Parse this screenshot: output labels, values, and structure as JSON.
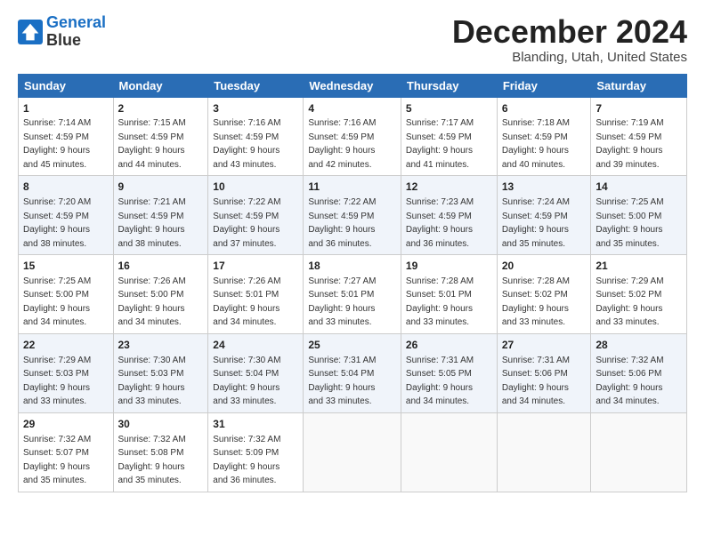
{
  "header": {
    "logo_line1": "General",
    "logo_line2": "Blue",
    "title": "December 2024",
    "subtitle": "Blanding, Utah, United States"
  },
  "days_of_week": [
    "Sunday",
    "Monday",
    "Tuesday",
    "Wednesday",
    "Thursday",
    "Friday",
    "Saturday"
  ],
  "weeks": [
    [
      {
        "day": "1",
        "info": "Sunrise: 7:14 AM\nSunset: 4:59 PM\nDaylight: 9 hours\nand 45 minutes."
      },
      {
        "day": "2",
        "info": "Sunrise: 7:15 AM\nSunset: 4:59 PM\nDaylight: 9 hours\nand 44 minutes."
      },
      {
        "day": "3",
        "info": "Sunrise: 7:16 AM\nSunset: 4:59 PM\nDaylight: 9 hours\nand 43 minutes."
      },
      {
        "day": "4",
        "info": "Sunrise: 7:16 AM\nSunset: 4:59 PM\nDaylight: 9 hours\nand 42 minutes."
      },
      {
        "day": "5",
        "info": "Sunrise: 7:17 AM\nSunset: 4:59 PM\nDaylight: 9 hours\nand 41 minutes."
      },
      {
        "day": "6",
        "info": "Sunrise: 7:18 AM\nSunset: 4:59 PM\nDaylight: 9 hours\nand 40 minutes."
      },
      {
        "day": "7",
        "info": "Sunrise: 7:19 AM\nSunset: 4:59 PM\nDaylight: 9 hours\nand 39 minutes."
      }
    ],
    [
      {
        "day": "8",
        "info": "Sunrise: 7:20 AM\nSunset: 4:59 PM\nDaylight: 9 hours\nand 38 minutes."
      },
      {
        "day": "9",
        "info": "Sunrise: 7:21 AM\nSunset: 4:59 PM\nDaylight: 9 hours\nand 38 minutes."
      },
      {
        "day": "10",
        "info": "Sunrise: 7:22 AM\nSunset: 4:59 PM\nDaylight: 9 hours\nand 37 minutes."
      },
      {
        "day": "11",
        "info": "Sunrise: 7:22 AM\nSunset: 4:59 PM\nDaylight: 9 hours\nand 36 minutes."
      },
      {
        "day": "12",
        "info": "Sunrise: 7:23 AM\nSunset: 4:59 PM\nDaylight: 9 hours\nand 36 minutes."
      },
      {
        "day": "13",
        "info": "Sunrise: 7:24 AM\nSunset: 4:59 PM\nDaylight: 9 hours\nand 35 minutes."
      },
      {
        "day": "14",
        "info": "Sunrise: 7:25 AM\nSunset: 5:00 PM\nDaylight: 9 hours\nand 35 minutes."
      }
    ],
    [
      {
        "day": "15",
        "info": "Sunrise: 7:25 AM\nSunset: 5:00 PM\nDaylight: 9 hours\nand 34 minutes."
      },
      {
        "day": "16",
        "info": "Sunrise: 7:26 AM\nSunset: 5:00 PM\nDaylight: 9 hours\nand 34 minutes."
      },
      {
        "day": "17",
        "info": "Sunrise: 7:26 AM\nSunset: 5:01 PM\nDaylight: 9 hours\nand 34 minutes."
      },
      {
        "day": "18",
        "info": "Sunrise: 7:27 AM\nSunset: 5:01 PM\nDaylight: 9 hours\nand 33 minutes."
      },
      {
        "day": "19",
        "info": "Sunrise: 7:28 AM\nSunset: 5:01 PM\nDaylight: 9 hours\nand 33 minutes."
      },
      {
        "day": "20",
        "info": "Sunrise: 7:28 AM\nSunset: 5:02 PM\nDaylight: 9 hours\nand 33 minutes."
      },
      {
        "day": "21",
        "info": "Sunrise: 7:29 AM\nSunset: 5:02 PM\nDaylight: 9 hours\nand 33 minutes."
      }
    ],
    [
      {
        "day": "22",
        "info": "Sunrise: 7:29 AM\nSunset: 5:03 PM\nDaylight: 9 hours\nand 33 minutes."
      },
      {
        "day": "23",
        "info": "Sunrise: 7:30 AM\nSunset: 5:03 PM\nDaylight: 9 hours\nand 33 minutes."
      },
      {
        "day": "24",
        "info": "Sunrise: 7:30 AM\nSunset: 5:04 PM\nDaylight: 9 hours\nand 33 minutes."
      },
      {
        "day": "25",
        "info": "Sunrise: 7:31 AM\nSunset: 5:04 PM\nDaylight: 9 hours\nand 33 minutes."
      },
      {
        "day": "26",
        "info": "Sunrise: 7:31 AM\nSunset: 5:05 PM\nDaylight: 9 hours\nand 34 minutes."
      },
      {
        "day": "27",
        "info": "Sunrise: 7:31 AM\nSunset: 5:06 PM\nDaylight: 9 hours\nand 34 minutes."
      },
      {
        "day": "28",
        "info": "Sunrise: 7:32 AM\nSunset: 5:06 PM\nDaylight: 9 hours\nand 34 minutes."
      }
    ],
    [
      {
        "day": "29",
        "info": "Sunrise: 7:32 AM\nSunset: 5:07 PM\nDaylight: 9 hours\nand 35 minutes."
      },
      {
        "day": "30",
        "info": "Sunrise: 7:32 AM\nSunset: 5:08 PM\nDaylight: 9 hours\nand 35 minutes."
      },
      {
        "day": "31",
        "info": "Sunrise: 7:32 AM\nSunset: 5:09 PM\nDaylight: 9 hours\nand 36 minutes."
      },
      null,
      null,
      null,
      null
    ]
  ]
}
